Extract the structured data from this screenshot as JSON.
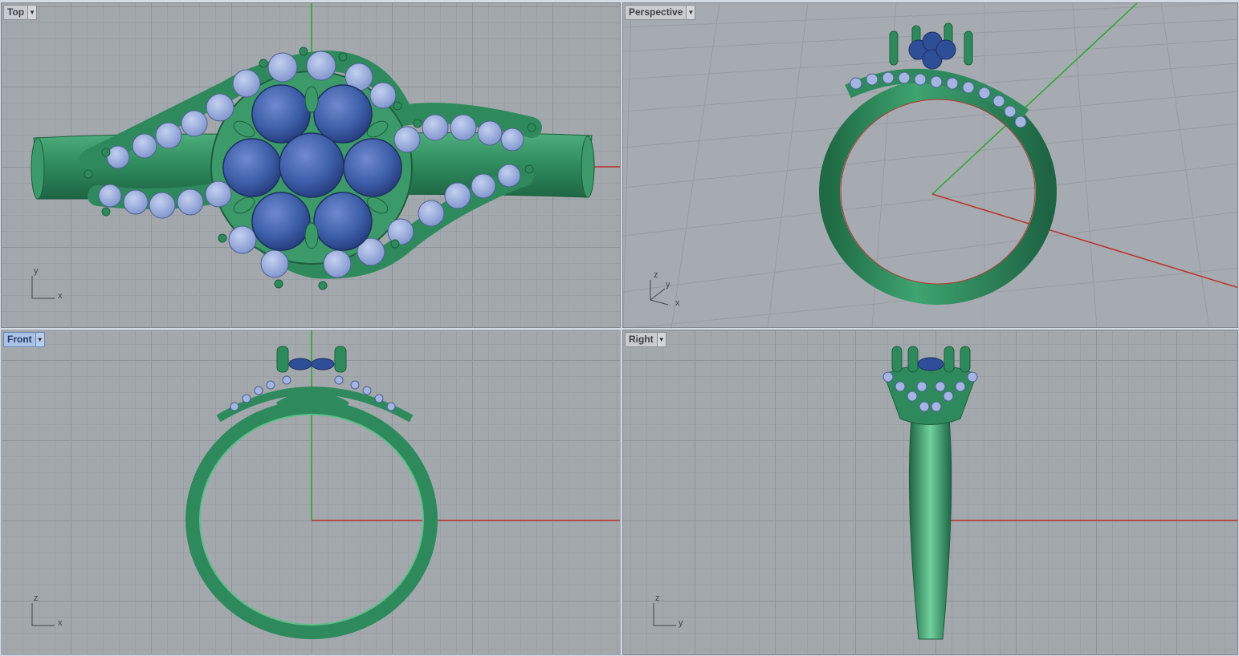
{
  "viewports": {
    "top": {
      "label": "Top",
      "axis_v": "y",
      "axis_h": "x",
      "active": false
    },
    "perspective": {
      "label": "Perspective",
      "axis_z": "z",
      "axis_y": "y",
      "axis_x": "x",
      "active": false
    },
    "front": {
      "label": "Front",
      "axis_v": "z",
      "axis_h": "x",
      "active": true
    },
    "right": {
      "label": "Right",
      "axis_v": "z",
      "axis_h": "y",
      "active": false
    }
  },
  "colors": {
    "metal": "#2e8a5c",
    "metal_light": "#5fbf8a",
    "metal_dark": "#1d5e3c",
    "center_stone": "#3d5ea8",
    "accent_stone": "#8fa3d8",
    "x_axis": "#b8322a",
    "y_axis": "#2ea52e"
  },
  "icons": {
    "dropdown": "chevron-down-icon"
  }
}
